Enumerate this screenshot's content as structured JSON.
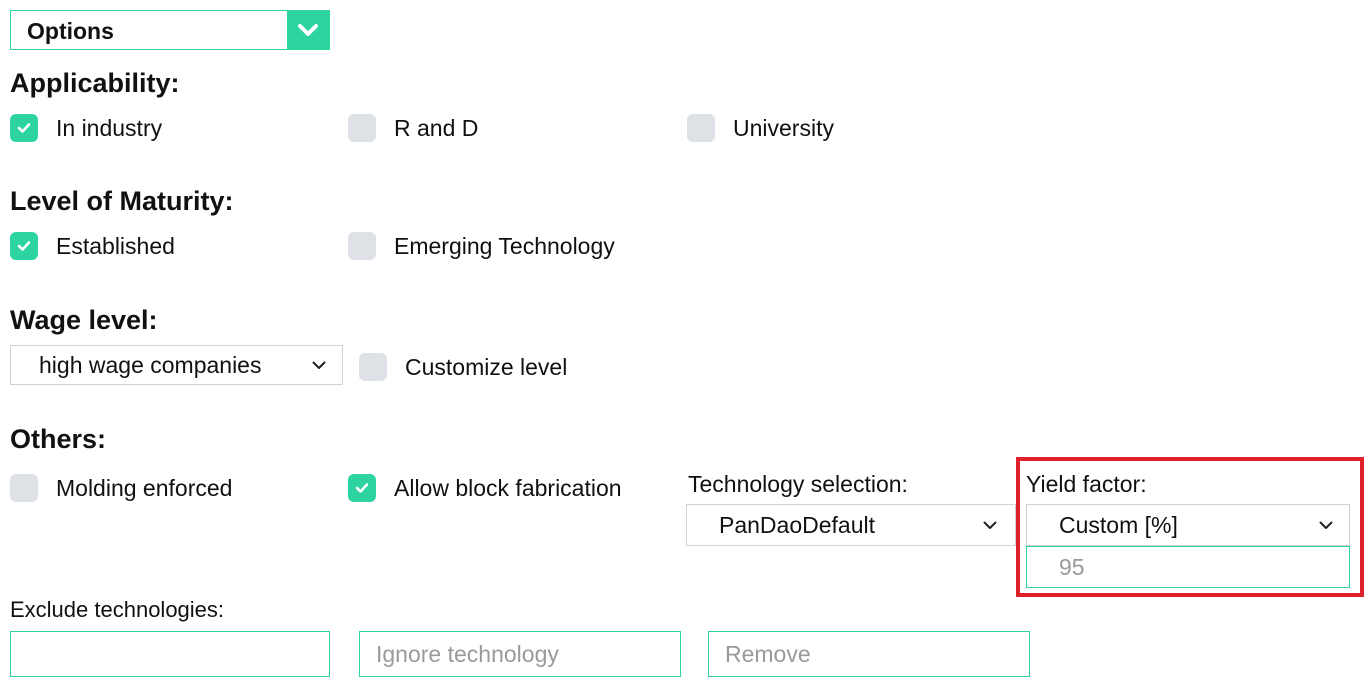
{
  "options": {
    "label": "Options"
  },
  "applicability": {
    "title": "Applicability:",
    "items": [
      {
        "label": "In industry",
        "checked": true
      },
      {
        "label": "R and D",
        "checked": false
      },
      {
        "label": "University",
        "checked": false
      }
    ]
  },
  "maturity": {
    "title": "Level of Maturity:",
    "items": [
      {
        "label": "Established",
        "checked": true
      },
      {
        "label": "Emerging Technology",
        "checked": false
      }
    ]
  },
  "wage": {
    "title": "Wage level:",
    "select_value": "high wage companies",
    "customize_label": "Customize level",
    "customize_checked": false
  },
  "others": {
    "title": "Others:",
    "molding_label": "Molding enforced",
    "molding_checked": false,
    "block_label": "Allow block fabrication",
    "block_checked": true,
    "tech_label": "Technology selection:",
    "tech_value": "PanDaoDefault",
    "yield_label": "Yield factor:",
    "yield_value": "Custom [%]",
    "yield_input_placeholder": "95"
  },
  "exclude": {
    "label": "Exclude technologies:",
    "input_value": "",
    "ignore_placeholder": "Ignore technology",
    "remove_placeholder": "Remove"
  },
  "colors": {
    "accent": "#2ed3a2",
    "unchecked": "#dee1e6",
    "highlight": "#e0202a"
  }
}
